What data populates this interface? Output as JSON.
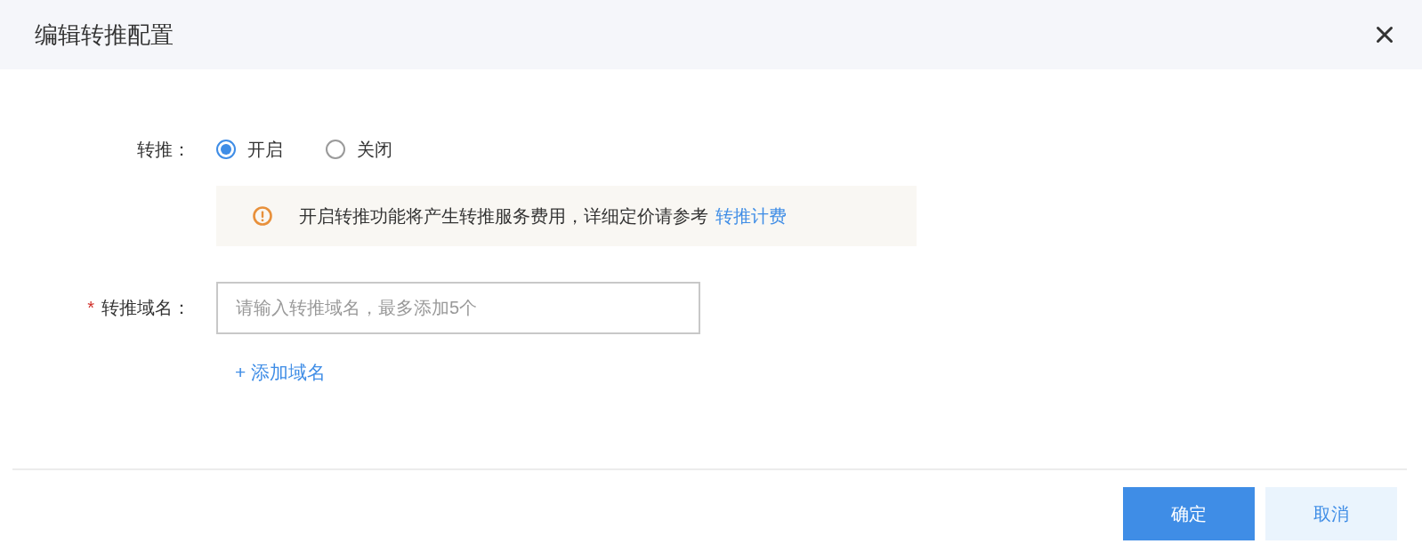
{
  "dialog": {
    "title": "编辑转推配置"
  },
  "form": {
    "push": {
      "label": "转推：",
      "options": [
        {
          "label": "开启",
          "selected": true
        },
        {
          "label": "关闭",
          "selected": false
        }
      ]
    },
    "notice": {
      "text": "开启转推功能将产生转推服务费用，详细定价请参考",
      "link": "转推计费"
    },
    "domain": {
      "required_mark": "*",
      "label": "转推域名：",
      "placeholder": "请输入转推域名，最多添加5个"
    },
    "add_domain": "+ 添加域名"
  },
  "buttons": [
    {
      "label": "确定",
      "kind": "primary"
    },
    {
      "label": "取消",
      "kind": "secondary"
    }
  ]
}
